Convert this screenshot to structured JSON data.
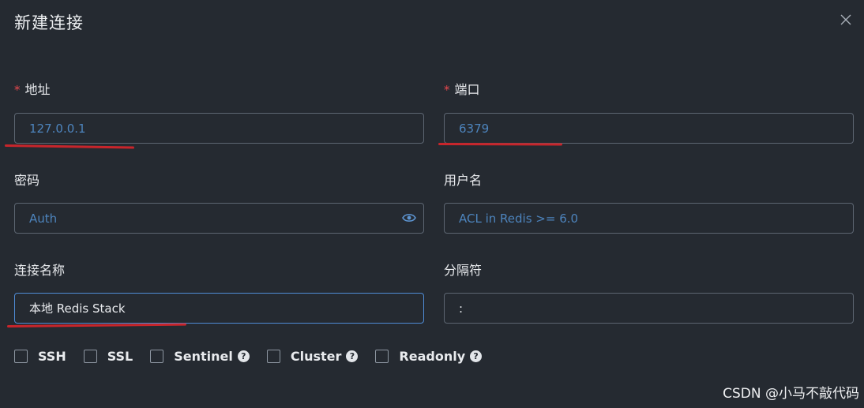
{
  "dialog": {
    "title": "新建连接",
    "close_icon": "close-icon"
  },
  "fields": {
    "address": {
      "label": "地址",
      "required_mark": "*",
      "placeholder": "127.0.0.1",
      "value": ""
    },
    "port": {
      "label": "端口",
      "required_mark": "*",
      "placeholder": "6379",
      "value": ""
    },
    "password": {
      "label": "密码",
      "placeholder": "Auth",
      "value": "",
      "toggle_icon": "eye-icon"
    },
    "username": {
      "label": "用户名",
      "placeholder": "ACL in Redis >= 6.0",
      "value": ""
    },
    "conn_name": {
      "label": "连接名称",
      "placeholder": "",
      "value": "本地 Redis Stack"
    },
    "separator": {
      "label": "分隔符",
      "placeholder": "",
      "value": ":"
    }
  },
  "options": [
    {
      "label": "SSH",
      "checked": false,
      "help": false
    },
    {
      "label": "SSL",
      "checked": false,
      "help": false
    },
    {
      "label": "Sentinel",
      "checked": false,
      "help": true
    },
    {
      "label": "Cluster",
      "checked": false,
      "help": true
    },
    {
      "label": "Readonly",
      "checked": false,
      "help": true
    }
  ],
  "help_glyph": "?",
  "watermark": "CSDN @小马不敲代码",
  "colors": {
    "background": "#252a31",
    "placeholder": "#4d84bd",
    "focus_border": "#4f8cd6",
    "required": "#e5484d",
    "annotation_underline": "#c8252b"
  }
}
